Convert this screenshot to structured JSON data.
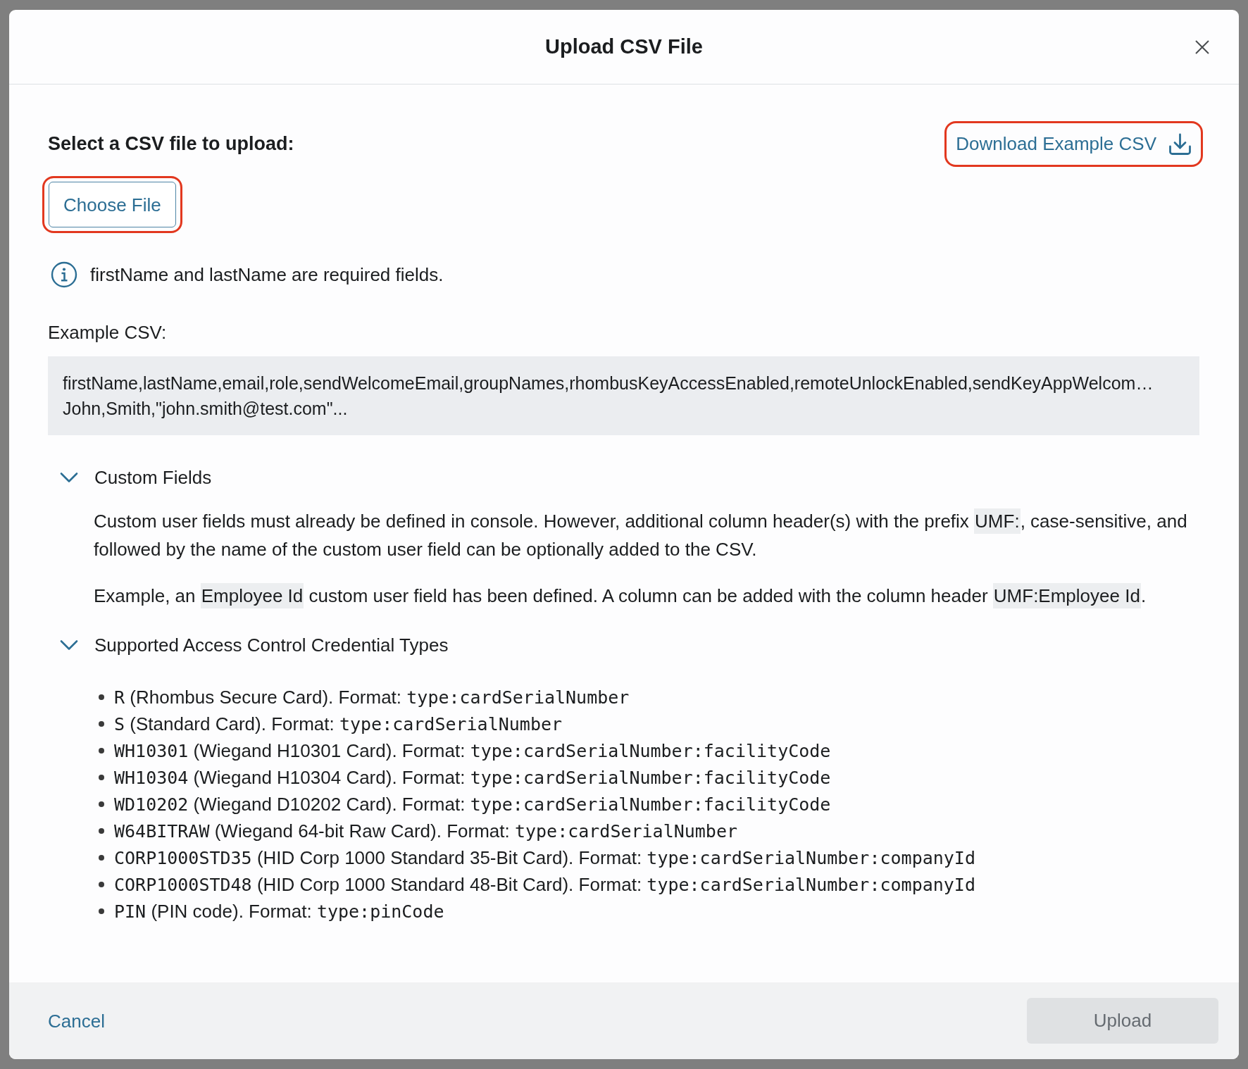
{
  "dialog": {
    "title": "Upload CSV File"
  },
  "upload": {
    "prompt": "Select a CSV file to upload:",
    "download_link": {
      "label": "Download Example CSV",
      "highlighted": true
    },
    "choose_file_button": {
      "label": "Choose File",
      "highlighted": true
    }
  },
  "info_note": "firstName and lastName are required fields.",
  "example_csv": {
    "label": "Example CSV:",
    "lines": [
      "firstName,lastName,email,role,sendWelcomeEmail,groupNames,rhombusKeyAccessEnabled,remoteUnlockEnabled,sendKeyAppWelcom…",
      "John,Smith,\"john.smith@test.com\"..."
    ]
  },
  "sections": [
    {
      "kind": "paragraphs",
      "title": "Custom Fields",
      "expanded": true,
      "paragraphs": [
        [
          {
            "kind": "plain",
            "text": "Custom user fields must already be defined in console. However, additional column header(s) with the prefix "
          },
          {
            "kind": "code",
            "text": "UMF:"
          },
          {
            "kind": "plain",
            "text": ", case-sensitive, and followed by the name of the custom user field can be optionally added to the CSV."
          }
        ],
        [
          {
            "kind": "plain",
            "text": "Example, an "
          },
          {
            "kind": "code",
            "text": "Employee Id"
          },
          {
            "kind": "plain",
            "text": " custom user field has been defined. A column can be added with the column header "
          },
          {
            "kind": "code",
            "text": "UMF:Employee Id"
          },
          {
            "kind": "plain",
            "text": "."
          }
        ]
      ]
    },
    {
      "kind": "list",
      "title": "Supported Access Control Credential Types",
      "expanded": true,
      "items": [
        {
          "code": "R",
          "description": "(Rhombus Secure Card). Format:",
          "format": "type:cardSerialNumber"
        },
        {
          "code": "S",
          "description": "(Standard Card). Format:",
          "format": "type:cardSerialNumber"
        },
        {
          "code": "WH10301",
          "description": "(Wiegand H10301 Card). Format:",
          "format": "type:cardSerialNumber:facilityCode"
        },
        {
          "code": "WH10304",
          "description": "(Wiegand H10304 Card). Format:",
          "format": "type:cardSerialNumber:facilityCode"
        },
        {
          "code": "WD10202",
          "description": "(Wiegand D10202 Card). Format:",
          "format": "type:cardSerialNumber:facilityCode"
        },
        {
          "code": "W64BITRAW",
          "description": "(Wiegand 64-bit Raw Card). Format:",
          "format": "type:cardSerialNumber"
        },
        {
          "code": "CORP1000STD35",
          "description": "(HID Corp 1000 Standard 35-Bit Card). Format:",
          "format": "type:cardSerialNumber:companyId"
        },
        {
          "code": "CORP1000STD48",
          "description": "(HID Corp 1000 Standard 48-Bit Card). Format:",
          "format": "type:cardSerialNumber:companyId"
        },
        {
          "code": "PIN",
          "description": "(PIN code). Format:",
          "format": "type:pinCode"
        }
      ]
    }
  ],
  "footer": {
    "cancel": "Cancel",
    "upload": {
      "label": "Upload",
      "disabled": true
    }
  }
}
